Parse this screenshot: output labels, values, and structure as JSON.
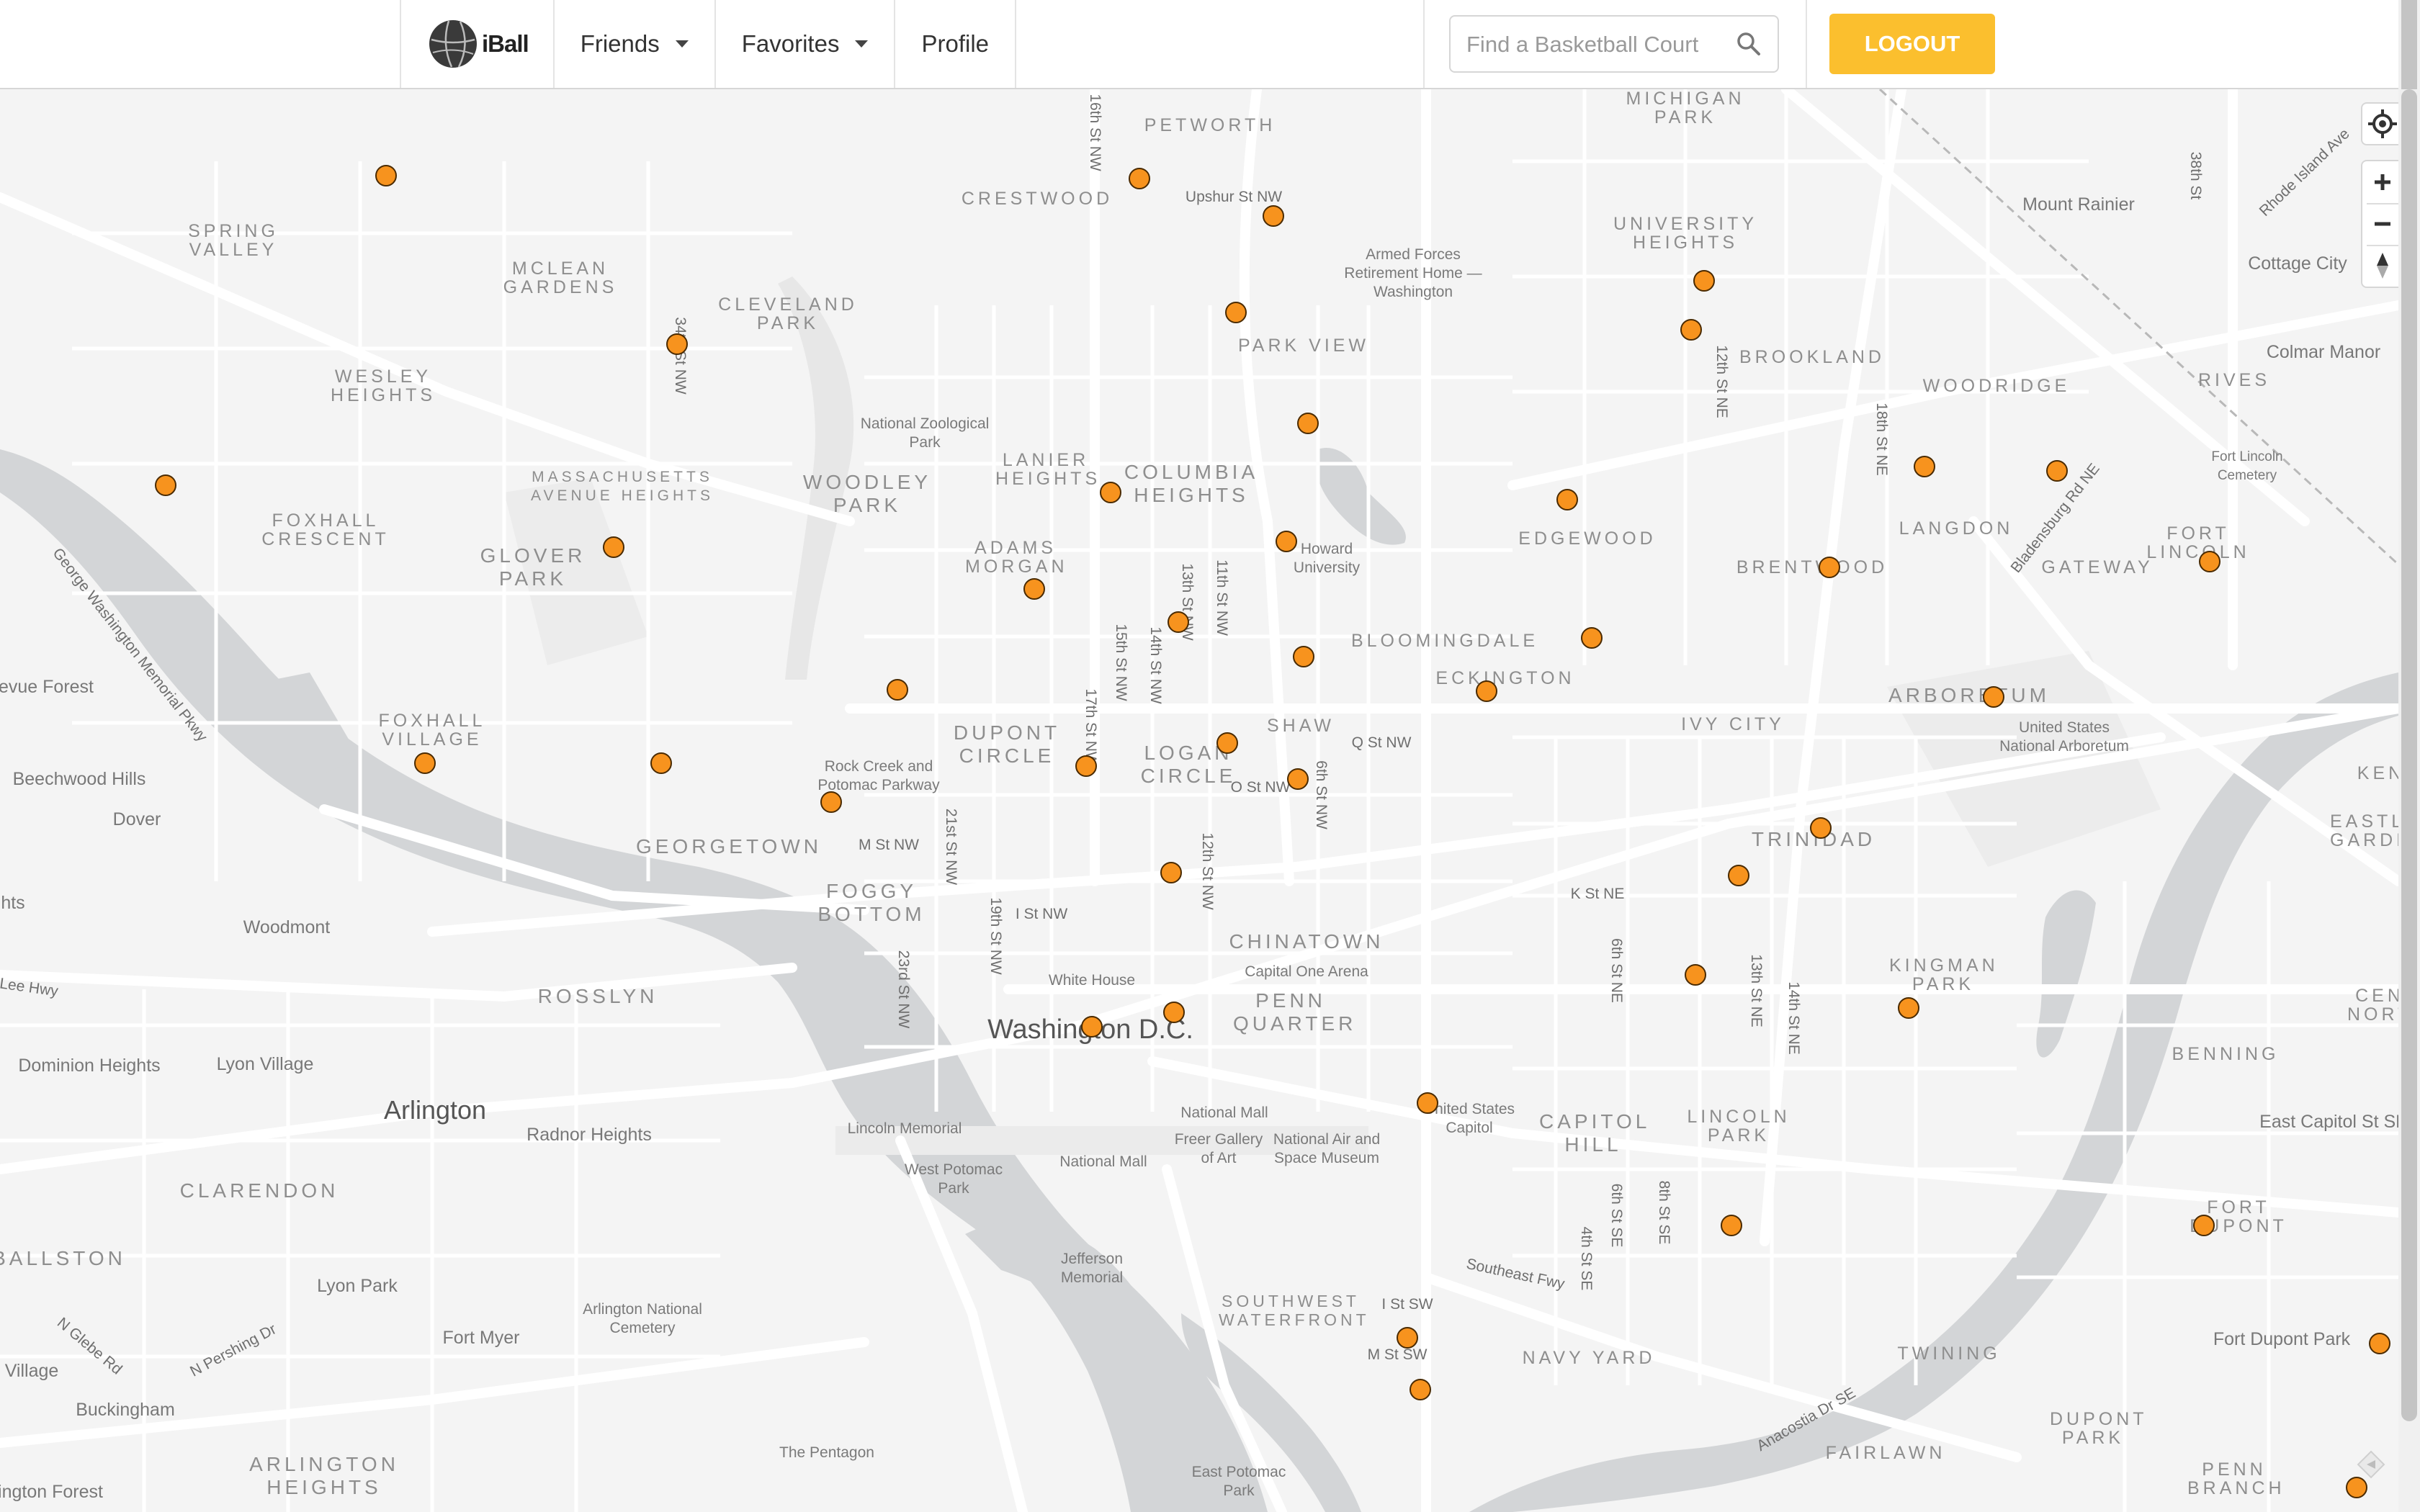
{
  "nav": {
    "brand": "iBall",
    "friends_label": "Friends",
    "favorites_label": "Favorites",
    "profile_label": "Profile",
    "search_placeholder": "Find a Basketball Court",
    "logout_label": "LOGOUT"
  },
  "colors": {
    "accent": "#fbbf2e",
    "court_marker": "#f7931e",
    "water": "#d4d6d8",
    "land": "#f4f4f4"
  },
  "map": {
    "controls": [
      "locate-icon",
      "zoom-in",
      "zoom-out",
      "compass-icon"
    ],
    "labels": {
      "petworth": "PETWORTH",
      "michigan_park": "MICHIGAN PARK",
      "crestwood": "CRESTWOOD",
      "upshur": "Upshur St NW",
      "spring_valley": "SPRING VALLEY",
      "mclean_gardens": "MCLEAN GARDENS",
      "cleveland_park": "CLEVELAND PARK",
      "armed_forces": "Armed Forces Retirement Home — Washington",
      "university_heights": "UNIVERSITY HEIGHTS",
      "mount_rainier": "Mount Rainier",
      "cottage_city": "Cottage City",
      "colmar_manor": "Colmar Manor",
      "wesley_heights": "WESLEY HEIGHTS",
      "park_view": "PARK VIEW",
      "brookland": "BROOKLAND",
      "woodridge": "WOODRIDGE",
      "rives": "RIVES",
      "national_zoo": "National Zoological Park",
      "lanier_heights": "LANIER HEIGHTS",
      "columbia_heights": "COLUMBIA HEIGHTS",
      "woodley_park": "WOODLEY PARK",
      "mass_heights": "MASSACHUSETTS AVENUE HEIGHTS",
      "foxhall_crescent": "FOXHALL CRESCENT",
      "glover_park": "GLOVER PARK",
      "edgewood": "EDGEWOOD",
      "langdon": "LANGDON",
      "fort_lincoln_cemetery": "Fort Lincoln Cemetery",
      "fort_lincoln": "FORT LINCOLN",
      "gateway": "GATEWAY",
      "brentwood": "BRENTWOOD",
      "adams_morgan": "ADAMS MORGAN",
      "howard": "Howard University",
      "gw_parkway": "George Washington Memorial Pkwy",
      "bloomingdale": "BLOOMINGDALE",
      "eckington": "ECKINGTON",
      "arboretum": "ARBORETUM",
      "us_arboretum": "United States National Arboretum",
      "bellevue_forest": "evue Forest",
      "foxhall_village": "FOXHALL VILLAGE",
      "beechwood_hills": "Beechwood Hills",
      "dupont_circle": "DUPONT CIRCLE",
      "logan_circle": "LOGAN CIRCLE",
      "shaw": "SHAW",
      "q_st": "Q St NW",
      "ivy_city": "IVY CITY",
      "o_st": "O St NW",
      "rock_creek": "Rock Creek and Potomac Parkway",
      "dover": "Dover",
      "kenilworth": "KEN",
      "eastland": "EASTLA GARDE",
      "georgetown": "GEORGETOWN",
      "m_st": "M St NW",
      "trinidad": "TRINIDAD",
      "foggy_bottom": "FOGGY BOTTOM",
      "i_st": "I St NW",
      "k_st_ne": "K St NE",
      "woodmont": "Woodmont",
      "hts": "hts",
      "chinatown": "CHINATOWN",
      "capital_one": "Capital One Arena",
      "kingman_park": "KINGMAN PARK",
      "lee_hwy": "Lee Hwy",
      "rosslyn": "ROSSLYN",
      "white_house": "White House",
      "washington_dc": "Washington D.C.",
      "penn_quarter": "PENN QUARTER",
      "cent_nort": "CEN NORT",
      "dominion_heights": "Dominion Heights",
      "lyon_village": "Lyon Village",
      "benning": "BENNING",
      "arlington": "Arlington",
      "radnor_heights": "Radnor Heights",
      "lincoln_memorial": "Lincoln Memorial",
      "national_mall_1": "National Mall",
      "us_capitol": "United States Capitol",
      "capitol_hill": "CAPITOL HILL",
      "lincoln_park": "LINCOLN PARK",
      "east_capitol": "East Capitol St SE",
      "freer": "Freer Gallery of Art",
      "air_space": "National Air and Space Museum",
      "national_mall_2": "National Mall",
      "clarendon": "CLARENDON",
      "west_potomac": "West Potomac Park",
      "fort_dupont": "FORT DUPONT",
      "ballston": "BALLSTON",
      "southeast_fwy": "Southeast Fwy",
      "lyon_park": "Lyon Park",
      "jefferson": "Jefferson Memorial",
      "sw_waterfront": "SOUTHWEST WATERFRONT",
      "i_st_sw": "I St SW",
      "arlington_cemetery": "Arlington National Cemetery",
      "n_glebe": "N Glebe Rd",
      "fort_myer": "Fort Myer",
      "n_pershing": "N Pershing Dr",
      "m_st_sw": "M St SW",
      "fort_dupont_park": "Fort Dupont Park",
      "twining": "TWINING",
      "navy_yard": "NAVY YARD",
      "village": "Village",
      "buckingham": "Buckingham",
      "anacostia_dr": "Anacostia Dr SE",
      "dupont_park": "DUPONT PARK",
      "pentagon": "The Pentagon",
      "fairlawn": "FAIRLAWN",
      "arlington_heights": "ARLINGTON HEIGHTS",
      "east_potomac": "East Potomac Park",
      "penn_branch": "PENN BRANCH",
      "ington_forest": "ington Forest",
      "st_16th": "16th St NW",
      "st_34th": "34th St NW",
      "st_38th": "38th St",
      "rhode_island": "Rhode Island Ave",
      "st_12th_ne": "12th St NE",
      "st_18th_ne": "18th St NE",
      "bladensburg": "Bladensburg Rd NE",
      "st_13th_nw": "13th St NW",
      "st_11th_nw": "11th St NW",
      "st_15th_nw": "15th St NW",
      "st_14th_nw": "14th St NW",
      "st_6th_nw": "6th St NW",
      "st_17th_nw": "17th St NW",
      "st_21st_nw": "21st St NW",
      "st_12th_nw": "12th St NW",
      "st_19th_nw": "19th St NW",
      "st_23rd_nw": "23rd St NW",
      "st_6th_ne": "6th St NE",
      "st_13th_ne": "13th St NE",
      "st_14th_ne": "14th St NE",
      "st_4th_se": "4th St SE",
      "st_6th_se": "6th St SE",
      "st_8th_se": "8th St SE"
    }
  }
}
